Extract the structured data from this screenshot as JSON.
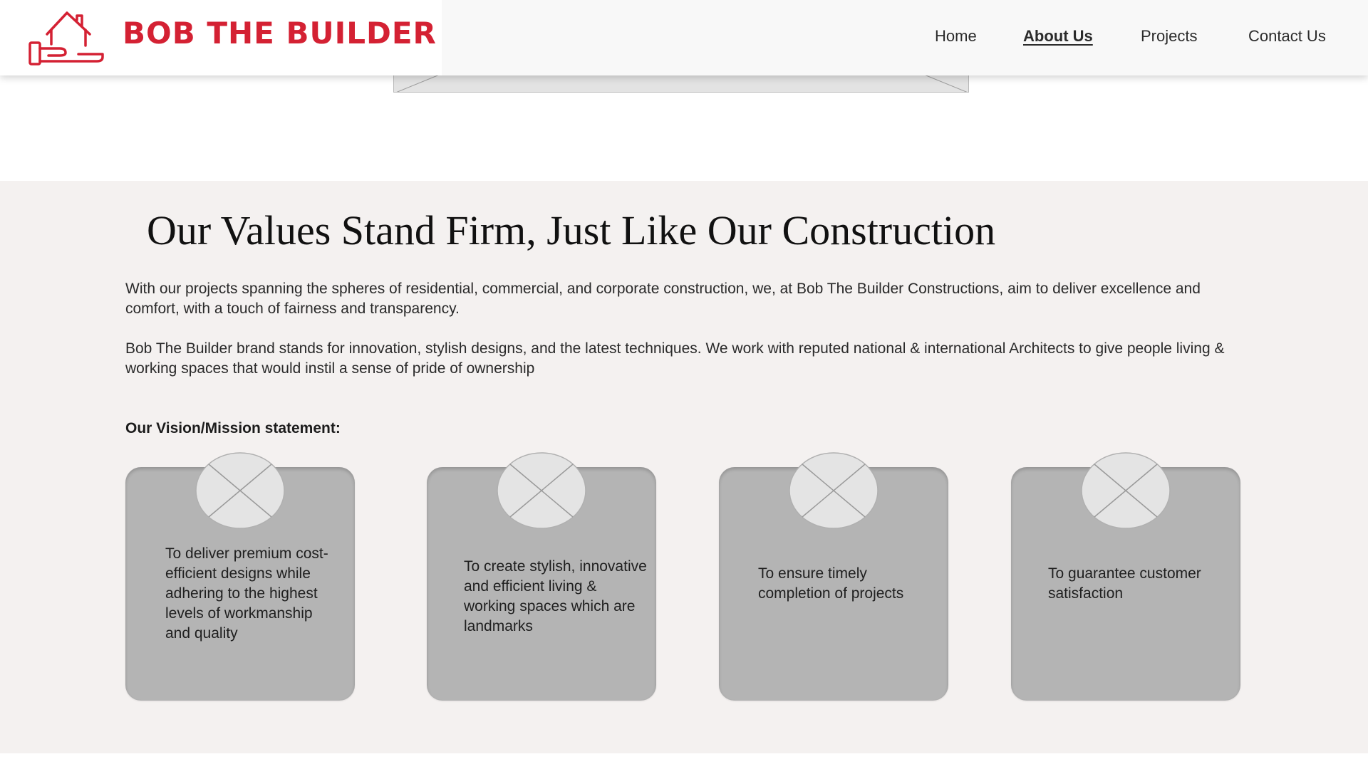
{
  "header": {
    "brand_name": "BOB THE BUILDER",
    "brand_color": "#d42133",
    "logo_icon": "house-on-hand-icon",
    "nav": {
      "home": "Home",
      "about": "About Us",
      "projects": "Projects",
      "contact": "Contact Us",
      "active": "About Us"
    }
  },
  "hero": {
    "image_placeholder_icon": "image-placeholder-icon"
  },
  "values": {
    "title": "Our Values Stand Firm, Just Like Our Construction",
    "paragraph1": "With our projects spanning the spheres of residential, commercial, and corporate construction, we, at Bob The Builder Constructions, aim to deliver excellence and comfort, with a touch of fairness and transparency.",
    "paragraph2": "Bob The Builder brand stands for innovation, stylish designs, and the latest techniques. We work with reputed national & international Architects to give people living & working spaces that would instil a sense of pride of ownership",
    "vision_label": "Our Vision/Mission statement:",
    "cards": [
      {
        "icon": "image-placeholder-icon",
        "text": "To deliver premium cost-efficient designs while adhering to the highest levels of workmanship and quality"
      },
      {
        "icon": "image-placeholder-icon",
        "text": "To create stylish, innovative and efficient living & working spaces which are landmarks"
      },
      {
        "icon": "image-placeholder-icon",
        "text": "To ensure timely completion of projects"
      },
      {
        "icon": "image-placeholder-icon",
        "text": "To guarantee customer satisfaction"
      }
    ]
  },
  "colors": {
    "section_background": "#f4f1f0",
    "card_background": "#b4b4b4"
  }
}
